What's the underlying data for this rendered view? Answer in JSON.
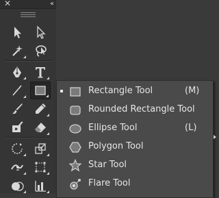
{
  "panel": {
    "close_glyph": "✕",
    "collapse_glyph": "‹‹",
    "tools": [
      {
        "name": "selection-tool-icon"
      },
      {
        "name": "direct-selection-tool-icon"
      },
      {
        "name": "magic-wand-tool-icon"
      },
      {
        "name": "lasso-tool-icon"
      },
      {
        "name": "pen-tool-icon"
      },
      {
        "name": "type-tool-icon"
      },
      {
        "name": "line-segment-tool-icon"
      },
      {
        "name": "rectangle-tool-icon"
      },
      {
        "name": "paintbrush-tool-icon"
      },
      {
        "name": "pencil-tool-icon"
      },
      {
        "name": "blob-brush-tool-icon"
      },
      {
        "name": "eraser-tool-icon"
      },
      {
        "name": "rotate-tool-icon"
      },
      {
        "name": "scale-tool-icon"
      },
      {
        "name": "width-tool-icon"
      },
      {
        "name": "free-transform-tool-icon"
      },
      {
        "name": "shape-builder-tool-icon"
      },
      {
        "name": "graph-tool-icon"
      }
    ]
  },
  "flyout": {
    "items": [
      {
        "label": "Rectangle Tool",
        "shortcut": "(M)",
        "icon": "rectangle-icon",
        "current": true
      },
      {
        "label": "Rounded Rectangle Tool",
        "shortcut": "",
        "icon": "rounded-rectangle-icon",
        "current": false
      },
      {
        "label": "Ellipse Tool",
        "shortcut": "(L)",
        "icon": "ellipse-icon",
        "current": false
      },
      {
        "label": "Polygon Tool",
        "shortcut": "",
        "icon": "polygon-icon",
        "current": false
      },
      {
        "label": "Star Tool",
        "shortcut": "",
        "icon": "star-icon",
        "current": false
      },
      {
        "label": "Flare Tool",
        "shortcut": "",
        "icon": "flare-icon",
        "current": false
      }
    ]
  },
  "colors": {
    "panel_bg": "#353535",
    "flyout_bg": "#4a4a4a",
    "text": "#e6e6e6",
    "icon": "#cfcfcf"
  }
}
